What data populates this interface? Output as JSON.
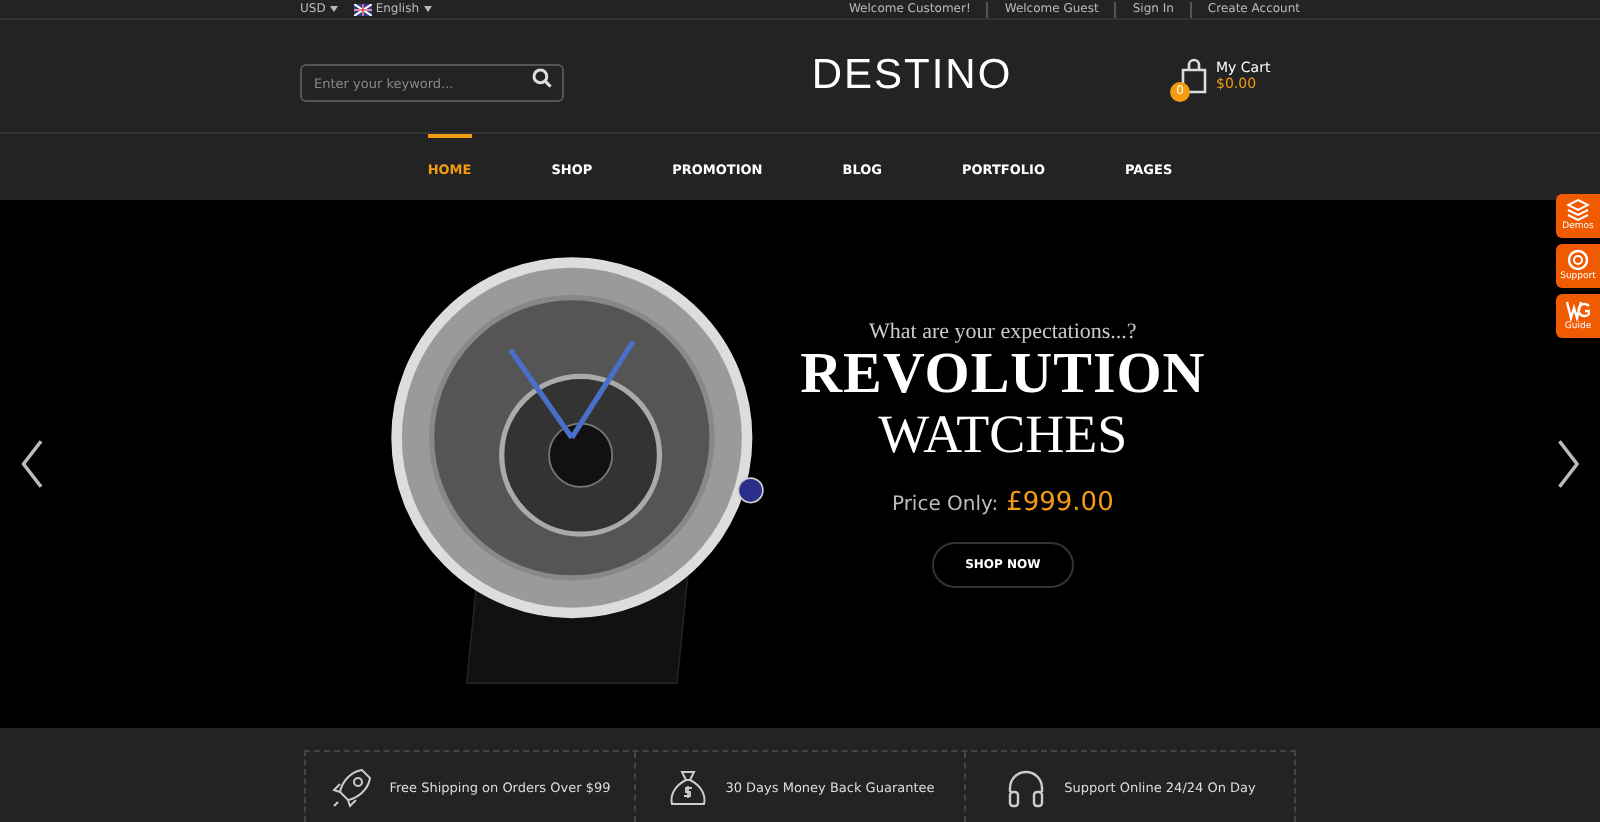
{
  "top_bar": {
    "currency": "USD",
    "language": "English",
    "links": [
      "Welcome Customer!",
      "Welcome Guest",
      "Sign In",
      "Create Account"
    ]
  },
  "header": {
    "search": {
      "placeholder": "Enter your keyword..."
    },
    "logo": "DESTINO",
    "cart": {
      "count": "0",
      "label": "My Cart",
      "total": "$0.00"
    }
  },
  "nav": [
    {
      "label": "HOME",
      "selected": true
    },
    {
      "label": "SHOP",
      "selected": false
    },
    {
      "label": "PROMOTION",
      "selected": false
    },
    {
      "label": "BLOG",
      "selected": false
    },
    {
      "label": "PORTFOLIO",
      "selected": false
    },
    {
      "label": "PAGES",
      "selected": false
    }
  ],
  "slider": {
    "subtitle": "What are your expectations...?",
    "title": "REVOLUTION",
    "title_2": "WATCHES",
    "price_label": "Price Only:",
    "price": "£999.00",
    "button": "SHOP NOW"
  },
  "side_widgets": [
    {
      "label": "Demos"
    },
    {
      "label": "Support"
    },
    {
      "label": "Guide"
    }
  ],
  "features": [
    {
      "kind": "rocket",
      "text": "Free Shipping on Orders Over $99"
    },
    {
      "kind": "moneybag",
      "text": "30 Days Money Back Guarantee"
    },
    {
      "kind": "headphones",
      "text": "Support Online 24/24 On Day"
    }
  ]
}
